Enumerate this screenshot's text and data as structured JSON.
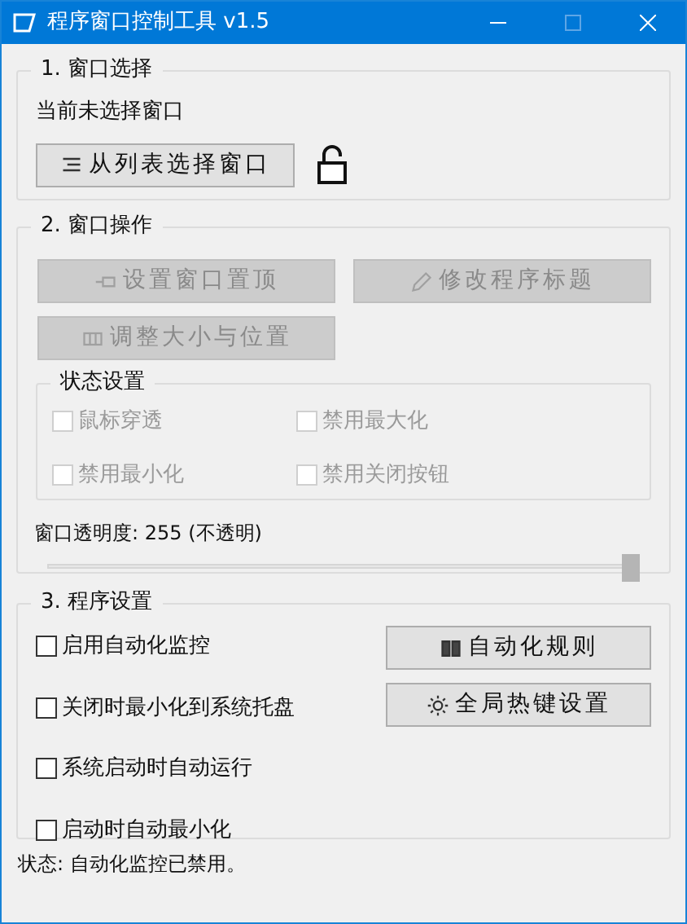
{
  "window": {
    "title": "程序窗口控制工具 v1.5"
  },
  "window_select": {
    "title": "1. 窗口选择",
    "current": "当前未选择窗口",
    "button": {
      "label": "从列表选择窗口",
      "disabled": false
    },
    "locked": false
  },
  "window_ops": {
    "title": "2. 窗口操作",
    "buttons": [
      {
        "label": "设置窗口置顶",
        "disabled": true
      },
      {
        "label": "修改程序标题",
        "disabled": true
      },
      {
        "label": "调整大小与位置",
        "disabled": true
      }
    ],
    "state_group": {
      "title": "状态设置",
      "options": [
        {
          "label": "鼠标穿透",
          "checked": false,
          "disabled": true
        },
        {
          "label": "禁用最大化",
          "checked": false,
          "disabled": true
        },
        {
          "label": "禁用最小化",
          "checked": false,
          "disabled": true
        },
        {
          "label": "禁用关闭按钮",
          "checked": false,
          "disabled": true
        }
      ]
    },
    "opacity": {
      "label": "窗口透明度: 255 (不透明)",
      "level": 1
    }
  },
  "program_settings": {
    "title": "3. 程序设置",
    "options": [
      {
        "label": "启用自动化监控",
        "checked": false
      },
      {
        "label": "关闭时最小化到系统托盘",
        "checked": false
      },
      {
        "label": "系统启动时自动运行",
        "checked": false
      },
      {
        "label": "启动时自动最小化",
        "checked": false
      }
    ],
    "buttons": [
      {
        "label": "自动化规则",
        "disabled": false
      },
      {
        "label": "全局热键设置",
        "disabled": false
      }
    ]
  },
  "status_bar": {
    "text": "状态: 自动化监控已禁用。"
  }
}
